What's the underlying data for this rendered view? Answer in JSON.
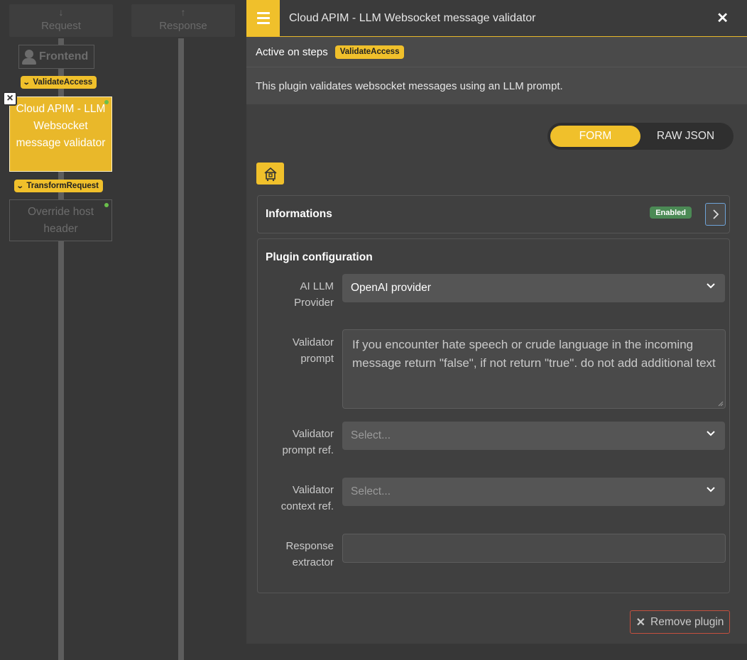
{
  "flow": {
    "request_label": "Request",
    "response_label": "Response",
    "frontend_label": "Frontend",
    "steps": {
      "validate_access": "ValidateAccess",
      "transform_request": "TransformRequest"
    },
    "active_plugin_label": "Cloud APIM - LLM Websocket message validator",
    "other_plugin_label": "Override host header",
    "active_plugin_color": "#e9b82a",
    "enabled_dot_color": "#6abf4b"
  },
  "panel": {
    "title": "Cloud APIM - LLM Websocket message validator",
    "active_on_steps_label": "Active on steps",
    "active_step_badge": "ValidateAccess",
    "description": "This plugin validates websocket messages using an LLM prompt.",
    "toggle": {
      "form_label": "FORM",
      "raw_json_label": "RAW JSON",
      "selected": "FORM"
    },
    "informations": {
      "title": "Informations",
      "status_badge": "Enabled"
    },
    "plugin_configuration": {
      "title": "Plugin configuration",
      "fields": {
        "provider": {
          "label": "AI LLM Provider",
          "value": "OpenAI provider"
        },
        "validator_prompt": {
          "label": "Validator prompt",
          "value": "If you encounter hate speech or crude language in the incoming message return \"false\", if not return \"true\". do not add additional text"
        },
        "validator_prompt_ref": {
          "label": "Validator prompt ref.",
          "placeholder": "Select..."
        },
        "validator_context_ref": {
          "label": "Validator context ref.",
          "placeholder": "Select..."
        },
        "response_extractor": {
          "label": "Response extractor",
          "value": ""
        }
      }
    },
    "remove_button_label": "Remove plugin",
    "accent_color": "#f0c02b"
  }
}
